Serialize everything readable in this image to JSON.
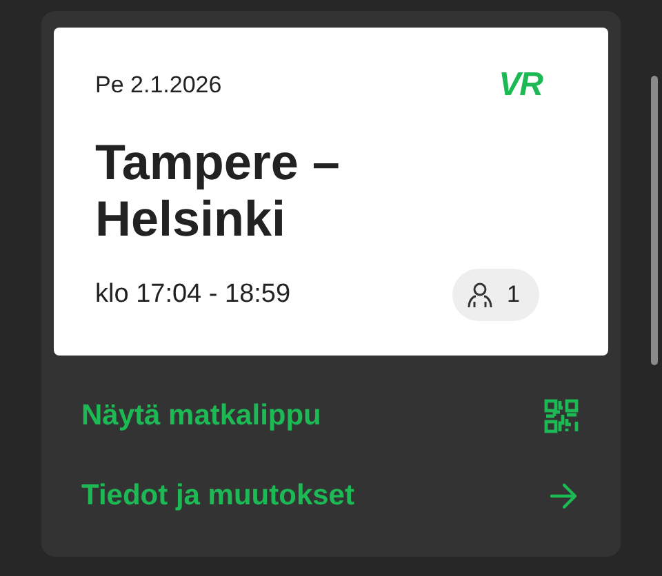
{
  "ticket": {
    "date": "Pe 2.1.2026",
    "logo": "VR",
    "route": "Tampere –\nHelsinki",
    "time": "klo 17:04 - 18:59",
    "passengers": "1"
  },
  "actions": [
    {
      "label": "Näytä matkalippu",
      "kind": "qr"
    },
    {
      "label": "Tiedot ja muutokset",
      "kind": "arrow"
    }
  ]
}
